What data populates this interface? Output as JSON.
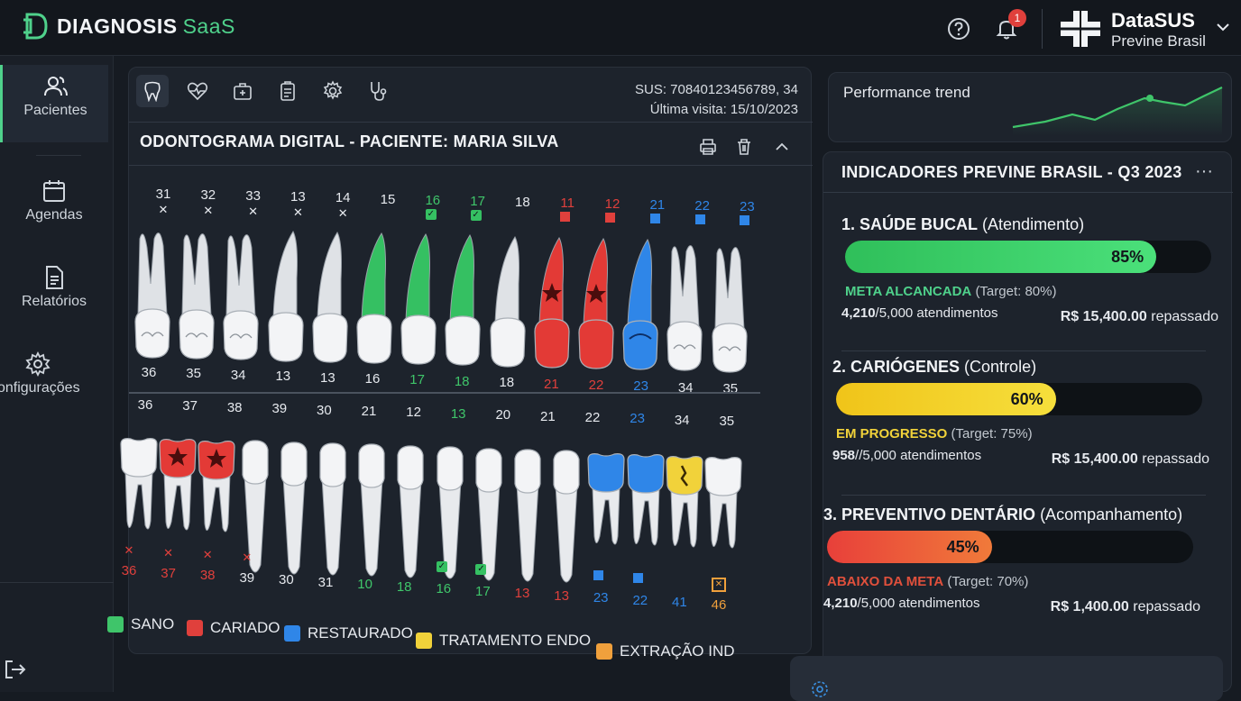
{
  "header": {
    "brand_main": "DIAGNOSIS",
    "brand_sub": "SaaS",
    "help_icon": "question-circle-icon",
    "notification_icon": "bell-icon",
    "notification_count": "1",
    "org_name": "DataSUS",
    "org_sub": "Previne Brasil"
  },
  "sidebar": {
    "items": [
      {
        "label": "Pacientes",
        "icon": "users-icon",
        "active": true
      },
      {
        "label": "Agendas",
        "icon": "calendar-icon",
        "active": false
      },
      {
        "label": "Relatórios",
        "icon": "document-icon",
        "active": false
      },
      {
        "label": "Configurações",
        "icon": "gear-icon",
        "active": false
      }
    ],
    "logout_icon": "logout-icon"
  },
  "odontogram": {
    "tabs": [
      "tooth-icon",
      "heart-pulse-icon",
      "medkit-icon",
      "clipboard-icon",
      "gear-icon",
      "stethoscope-icon"
    ],
    "sus_line": "SUS: 70840123456789, 34",
    "last_visit": "Última visita: 15/10/2023",
    "title": "ODONTOGRAMA DIGITAL - PACIENTE: MARIA SILVA",
    "upper_labels": [
      {
        "n": "31",
        "c": "#e6e9ee",
        "m": "x"
      },
      {
        "n": "32",
        "c": "#e6e9ee",
        "m": "x"
      },
      {
        "n": "33",
        "c": "#e6e9ee",
        "m": "x"
      },
      {
        "n": "13",
        "c": "#e6e9ee",
        "m": "x"
      },
      {
        "n": "14",
        "c": "#e6e9ee",
        "m": "x"
      },
      {
        "n": "15",
        "c": "#e6e9ee",
        "m": ""
      },
      {
        "n": "16",
        "c": "#3fc56a",
        "m": "check"
      },
      {
        "n": "17",
        "c": "#3fc56a",
        "m": "check"
      },
      {
        "n": "18",
        "c": "#e6e9ee",
        "m": ""
      },
      {
        "n": "11",
        "c": "#e0403c",
        "m": "sq-red"
      },
      {
        "n": "12",
        "c": "#e0403c",
        "m": "sq-red"
      },
      {
        "n": "21",
        "c": "#2f86e8",
        "m": "sq-blue"
      },
      {
        "n": "22",
        "c": "#2f86e8",
        "m": "sq-blue"
      },
      {
        "n": "23",
        "c": "#2f86e8",
        "m": "sq-blue"
      }
    ],
    "upper_teeth": [
      "white",
      "white",
      "white",
      "white",
      "white",
      "green",
      "green",
      "green",
      "white",
      "red",
      "red",
      "blue",
      "white",
      "white"
    ],
    "upper_row2": [
      {
        "n": "36",
        "c": "#e6e9ee"
      },
      {
        "n": "35",
        "c": "#e6e9ee"
      },
      {
        "n": "34",
        "c": "#e6e9ee"
      },
      {
        "n": "13",
        "c": "#e6e9ee"
      },
      {
        "n": "13",
        "c": "#e6e9ee"
      },
      {
        "n": "16",
        "c": "#e6e9ee"
      },
      {
        "n": "17",
        "c": "#3fc56a"
      },
      {
        "n": "18",
        "c": "#3fc56a"
      },
      {
        "n": "18",
        "c": "#e6e9ee"
      },
      {
        "n": "21",
        "c": "#e0403c"
      },
      {
        "n": "22",
        "c": "#e0403c"
      },
      {
        "n": "23",
        "c": "#2f86e8"
      },
      {
        "n": "34",
        "c": "#e6e9ee"
      },
      {
        "n": "35",
        "c": "#e6e9ee"
      }
    ],
    "lower_row1": [
      {
        "n": "36",
        "c": "#e6e9ee"
      },
      {
        "n": "37",
        "c": "#e6e9ee"
      },
      {
        "n": "38",
        "c": "#e6e9ee"
      },
      {
        "n": "39",
        "c": "#e6e9ee"
      },
      {
        "n": "30",
        "c": "#e6e9ee"
      },
      {
        "n": "21",
        "c": "#e6e9ee"
      },
      {
        "n": "12",
        "c": "#e6e9ee"
      },
      {
        "n": "13",
        "c": "#3fc56a"
      },
      {
        "n": "20",
        "c": "#e6e9ee"
      },
      {
        "n": "21",
        "c": "#e6e9ee"
      },
      {
        "n": "22",
        "c": "#e6e9ee"
      },
      {
        "n": "23",
        "c": "#2f86e8"
      },
      {
        "n": "34",
        "c": "#e6e9ee"
      },
      {
        "n": "35",
        "c": "#e6e9ee"
      }
    ],
    "lower_teeth": [
      "white",
      "red",
      "red",
      "white",
      "white",
      "white",
      "white",
      "white",
      "white",
      "white",
      "white",
      "white",
      "blue",
      "blue",
      "yellow",
      "white"
    ],
    "lower_labels": [
      {
        "n": "36",
        "c": "#e0403c",
        "m": "x-red"
      },
      {
        "n": "37",
        "c": "#e0403c",
        "m": "x-red"
      },
      {
        "n": "38",
        "c": "#e0403c",
        "m": "x-red"
      },
      {
        "n": "39",
        "c": "#e6e9ee",
        "m": "x-red"
      },
      {
        "n": "30",
        "c": "#e6e9ee",
        "m": ""
      },
      {
        "n": "31",
        "c": "#e6e9ee",
        "m": ""
      },
      {
        "n": "10",
        "c": "#3fc56a",
        "m": ""
      },
      {
        "n": "18",
        "c": "#3fc56a",
        "m": ""
      },
      {
        "n": "16",
        "c": "#3fc56a",
        "m": "check"
      },
      {
        "n": "17",
        "c": "#3fc56a",
        "m": "check"
      },
      {
        "n": "13",
        "c": "#e0403c",
        "m": ""
      },
      {
        "n": "13",
        "c": "#e0403c",
        "m": ""
      },
      {
        "n": "23",
        "c": "#2f86e8",
        "m": "sq-blue"
      },
      {
        "n": "22",
        "c": "#2f86e8",
        "m": "sq-blue"
      },
      {
        "n": "41",
        "c": "#2f86e8",
        "m": ""
      },
      {
        "n": "46",
        "c": "#f0a03c",
        "m": "x-orange"
      }
    ],
    "legend": [
      {
        "label": "SANO",
        "color": "#3fc56a"
      },
      {
        "label": "CARIADO",
        "color": "#e0403c"
      },
      {
        "label": "RESTAURADO",
        "color": "#2f86e8"
      },
      {
        "label": "TRATAMENTO ENDO",
        "color": "#f1d23a"
      },
      {
        "label": "EXTRAÇÃO IND",
        "color": "#f0a03c"
      }
    ]
  },
  "trend": {
    "title": "Performance trend",
    "color": "#3fc56a"
  },
  "indicators": {
    "title": "INDICADORES PREVINE BRASIL - Q3 2023",
    "items": [
      {
        "title_bold": "1. SAÚDE BUCAL",
        "title_rest": "(Atendimento)",
        "percent_label": "85%",
        "percent": 0.85,
        "status": "META ALCANCADA",
        "status_color": "#4fd18b",
        "target": "(Target: 80%)",
        "count_bold": "4,210",
        "count_rest": "/5,000 atendimentos",
        "amount_bold": "R$ 15,400.00",
        "amount_rest": "repassado",
        "grad_start": "#2fbf5a",
        "grad_end": "#4be07a"
      },
      {
        "title_bold": "2. CARIÓGENES",
        "title_rest": "(Controle)",
        "percent_label": "60%",
        "percent": 0.6,
        "status": "EM PROGRESSO",
        "status_color": "#f1d23a",
        "target": "(Target: 75%)",
        "count_bold": "958",
        "count_rest": "//5,000 atendimentos",
        "amount_bold": "R$ 15,400.00",
        "amount_rest": "repassado",
        "grad_start": "#f0c419",
        "grad_end": "#f6df3c"
      },
      {
        "title_bold": "3. PREVENTIVO DENTÁRIO",
        "title_rest": "(Acompanhamento)",
        "percent_label": "45%",
        "percent": 0.45,
        "status": "ABAIXO DA META",
        "status_color": "#e0503c",
        "target": "(Target: 70%)",
        "count_bold": "4,210",
        "count_rest": "/5,000 atendimentos",
        "amount_bold": "R$ 1,400.00",
        "amount_rest": "repassado",
        "grad_start": "#e8403a",
        "grad_end": "#f07a3a"
      }
    ]
  }
}
